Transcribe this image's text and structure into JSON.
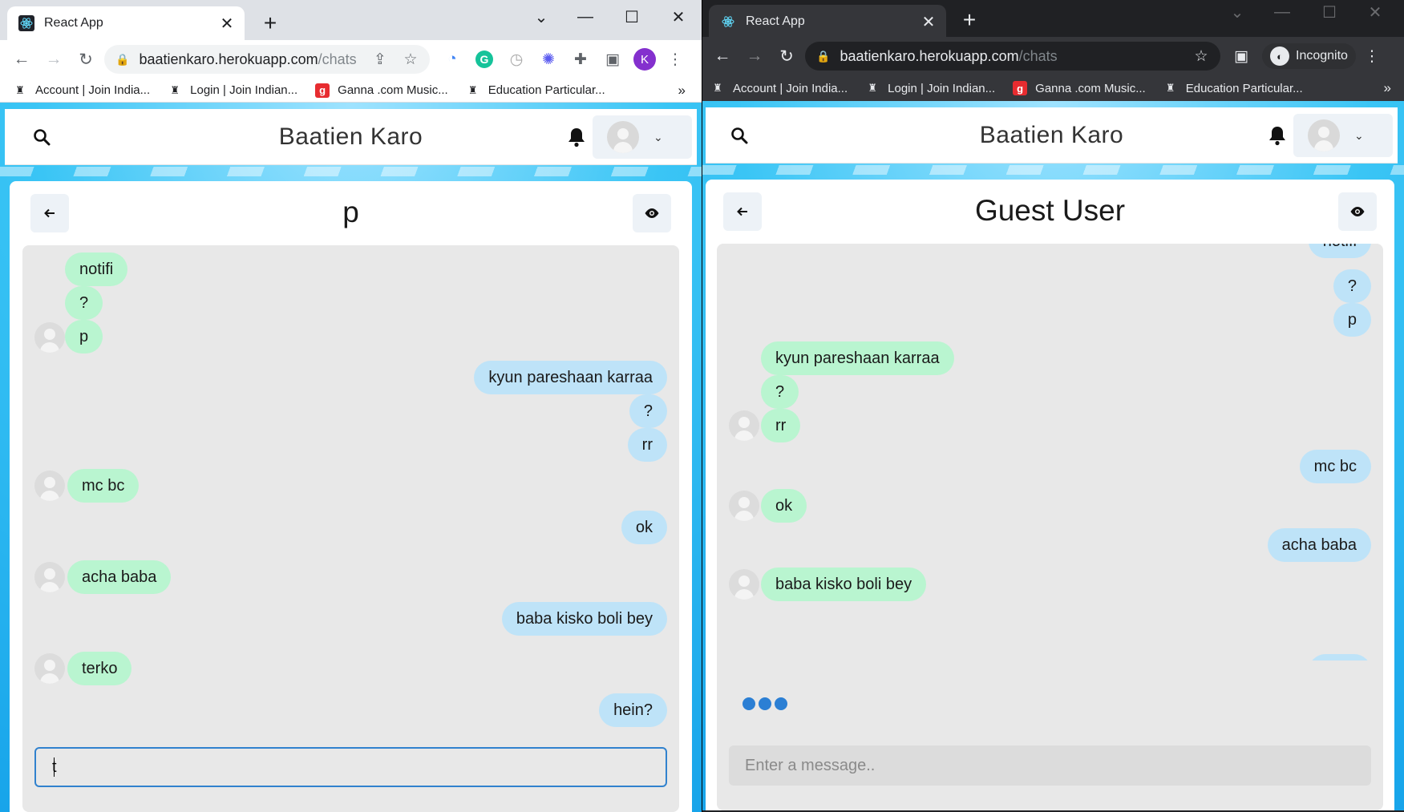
{
  "left_window": {
    "tab_title": "React App",
    "url_host": "baatienkaro.herokuapp.com",
    "url_path": "/chats",
    "profile_letter": "K",
    "bookmarks": [
      "Account | Join India...",
      "Login | Join Indian...",
      "Ganna .com Music...",
      "Education Particular..."
    ],
    "bookmarks_more": "»",
    "app_title": "Baatien Karo",
    "chat_name": "p",
    "messages": [
      {
        "text": "notifi",
        "side": "in"
      },
      {
        "text": "?",
        "side": "in"
      },
      {
        "text": "p",
        "side": "in"
      },
      {
        "text": "kyun pareshaan karraa",
        "side": "out"
      },
      {
        "text": "?",
        "side": "out"
      },
      {
        "text": "rr",
        "side": "out"
      },
      {
        "text": "mc bc",
        "side": "in"
      },
      {
        "text": "ok",
        "side": "out"
      },
      {
        "text": "acha baba",
        "side": "in"
      },
      {
        "text": "baba kisko boli bey",
        "side": "out"
      },
      {
        "text": "terko",
        "side": "in"
      },
      {
        "text": "hein?",
        "side": "out"
      }
    ],
    "input_value": "t"
  },
  "right_window": {
    "tab_title": "React App",
    "url_host": "baatienkaro.herokuapp.com",
    "url_path": "/chats",
    "incognito_label": "Incognito",
    "bookmarks": [
      "Account | Join India...",
      "Login | Join Indian...",
      "Ganna .com Music...",
      "Education Particular..."
    ],
    "bookmarks_more": "»",
    "app_title": "Baatien Karo",
    "chat_name": "Guest User",
    "messages": [
      {
        "text": "notifi",
        "side": "out"
      },
      {
        "text": "?",
        "side": "out"
      },
      {
        "text": "p",
        "side": "out"
      },
      {
        "text": "kyun pareshaan karraa",
        "side": "in"
      },
      {
        "text": "?",
        "side": "in"
      },
      {
        "text": "rr",
        "side": "in"
      },
      {
        "text": "mc bc",
        "side": "out"
      },
      {
        "text": "ok",
        "side": "in"
      },
      {
        "text": "acha baba",
        "side": "out"
      },
      {
        "text": "baba kisko boli bey",
        "side": "in"
      }
    ],
    "input_placeholder": "Enter a message.."
  },
  "colors": {
    "incoming_bubble": "#b9f5d0",
    "outgoing_bubble": "#bee3f8",
    "input_focus_border": "#3182ce",
    "typing_dots": "#2b7fd4",
    "page_background": "#17a4ea"
  },
  "icons": [
    "react-favicon-icon",
    "close-icon",
    "plus-icon",
    "back-arrow-icon",
    "forward-arrow-icon",
    "reload-icon",
    "lock-icon",
    "share-icon",
    "star-icon",
    "extension-icon",
    "side-panel-icon",
    "kebab-menu-icon",
    "search-icon",
    "bell-icon",
    "avatar",
    "chevron-down-icon",
    "eye-icon",
    "incognito-icon"
  ]
}
